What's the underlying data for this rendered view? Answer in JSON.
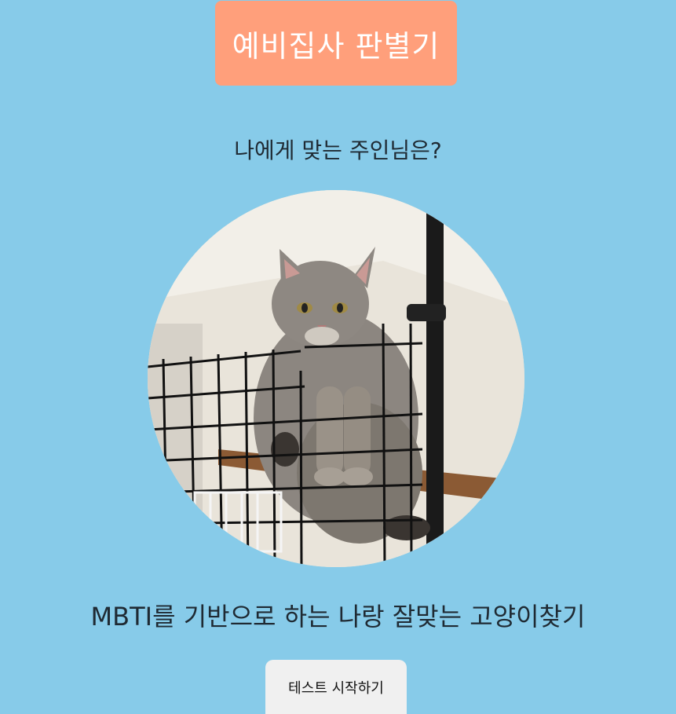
{
  "header": {
    "title": "예비집사 판별기"
  },
  "main": {
    "question": "나에게 맞는 주인님은?",
    "image_subject": "cat-photo",
    "tagline": "MBTI를 기반으로 하는 나랑 잘맞는 고양이찾기",
    "start_button_label": "테스트 시작하기"
  },
  "colors": {
    "background": "#87cbe9",
    "title_box": "#ff9f7b",
    "button": "#f0f0f0"
  }
}
